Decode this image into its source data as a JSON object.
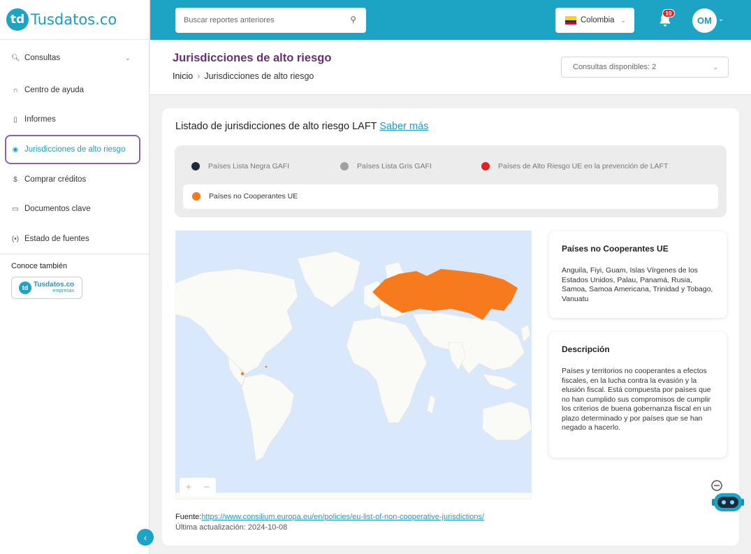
{
  "app": {
    "logo_mark": "td",
    "logo_text": "Tusdatos.co"
  },
  "sidebar": {
    "items": [
      {
        "label": "Consultas",
        "icon": "search-doc-icon"
      },
      {
        "label": "Centro de ayuda",
        "icon": "headset-icon"
      },
      {
        "label": "Informes",
        "icon": "document-icon"
      },
      {
        "label": "Jurisdicciones de alto riesgo",
        "icon": "globe-icon",
        "active": true
      },
      {
        "label": "Comprar créditos",
        "icon": "coin-icon"
      },
      {
        "label": "Documentos clave",
        "icon": "folder-icon"
      },
      {
        "label": "Estado de fuentes",
        "icon": "broadcast-icon"
      }
    ],
    "also_label": "Conoce también",
    "partner": {
      "mark": "td",
      "line1": "Tusdatos.co",
      "line2": "empresas"
    }
  },
  "topbar": {
    "search_placeholder": "Buscar reportes anteriores",
    "country": "Colombia",
    "notifications": "10",
    "avatar": "OM"
  },
  "header": {
    "title": "Jurisdicciones de alto riesgo",
    "breadcrumb_home": "Inicio",
    "breadcrumb_current": "Jurisdicciones de alto riesgo",
    "credits": "Consultas disponibles: 2"
  },
  "card": {
    "title": "Listado de jurisdicciones de alto riesgo LAFT",
    "link": "Saber más",
    "legend": [
      {
        "label": "Países Lista Negra GAFI",
        "color": "#1e2a3a"
      },
      {
        "label": "Países Lista Gris GAFI",
        "color": "#a0a0a0"
      },
      {
        "label": "Países de Alto Riesgo UE en la prevención de LAFT",
        "color": "#dd2222"
      },
      {
        "label": "Países no Cooperantes UE",
        "color": "#f77a1c",
        "active": true
      }
    ],
    "info_title": "Países no Cooperantes UE",
    "info_text": "Anguila, Fiyi, Guam, Islas Vírgenes de los Estados Unidos, Palau, Panamá, Rusia, Samoa, Samoa Americana, Trinidad y Tobago, Vanuatu",
    "desc_title": "Descripción",
    "desc_text": "Países y territorios no cooperantes a efectos fiscales, en la lucha contra la evasión y la elusión fiscal. Está compuesta por países que no han cumplido sus compromisos de cumplir los criterios de buena gobernanza fiscal en un plazo determinado y por países que se han negado a hacerlo.",
    "source_label": "Fuente:",
    "source_url": "https://www.consilium.europa.eu/en/policies/eu-list-of-non-cooperative-jurisdictions/",
    "updated": "Última actualización: 2024-10-08",
    "zoom_in": "+",
    "zoom_out": "−"
  },
  "colors": {
    "brand": "#1da3c4",
    "title": "#6b2d7a",
    "highlight": "#f77a1c",
    "ocean": "#d9e9fb",
    "land": "#fafaf7"
  }
}
